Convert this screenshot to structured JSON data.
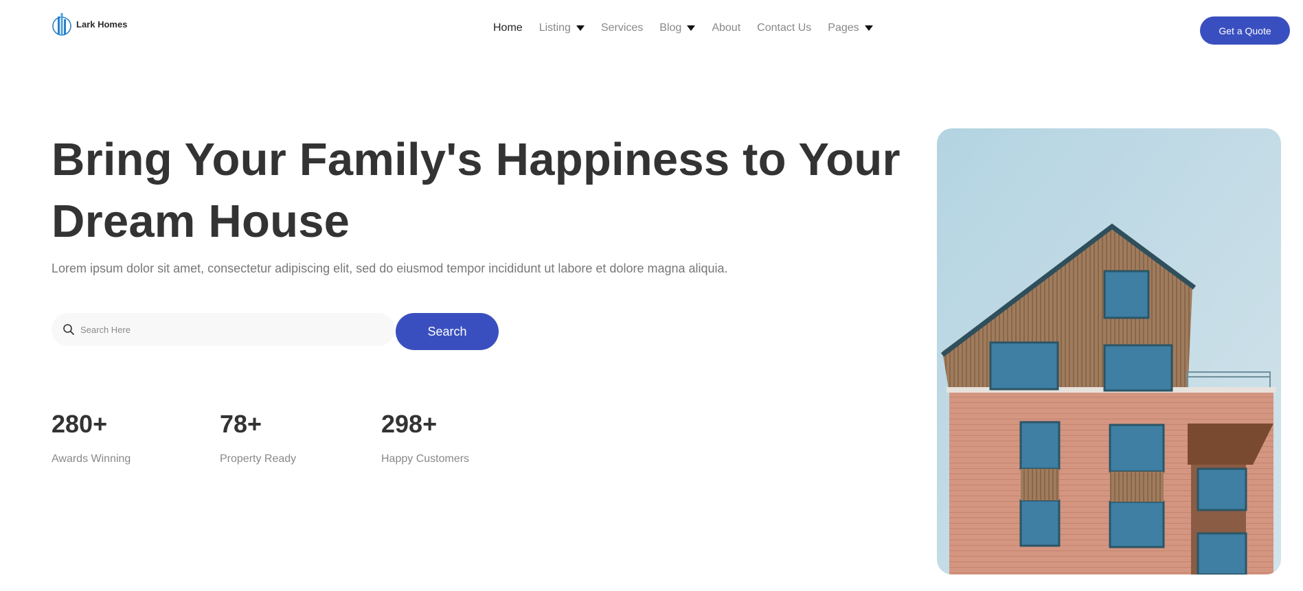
{
  "brand": {
    "name": "Lark Homes",
    "logo_icon": "building-logo-icon"
  },
  "nav": {
    "items": [
      {
        "label": "Home",
        "active": true,
        "dropdown": false
      },
      {
        "label": "Listing",
        "active": false,
        "dropdown": true
      },
      {
        "label": "Services",
        "active": false,
        "dropdown": false
      },
      {
        "label": "Blog",
        "active": false,
        "dropdown": true
      },
      {
        "label": "About",
        "active": false,
        "dropdown": false
      },
      {
        "label": "Contact Us",
        "active": false,
        "dropdown": false
      },
      {
        "label": "Pages",
        "active": false,
        "dropdown": true
      }
    ],
    "cta_label": "Get a Quote"
  },
  "hero": {
    "title": "Bring Your Family's Happiness to Your Dream House",
    "subtitle": "Lorem ipsum dolor sit amet, consectetur adipiscing elit, sed do eiusmod tempor incididunt ut labore et dolore magna aliquia.",
    "search": {
      "placeholder": "Search Here",
      "value": "",
      "button_label": "Search",
      "icon": "search-icon"
    },
    "image_icon": "house-photo"
  },
  "stats": [
    {
      "value": "280+",
      "label": "Awards Winning"
    },
    {
      "value": "78+",
      "label": "Property Ready"
    },
    {
      "value": "298+",
      "label": "Happy Customers"
    }
  ],
  "colors": {
    "accent": "#3a4fbf",
    "heading": "#333333",
    "muted": "#888888",
    "search_bg": "#f8f8f8"
  }
}
